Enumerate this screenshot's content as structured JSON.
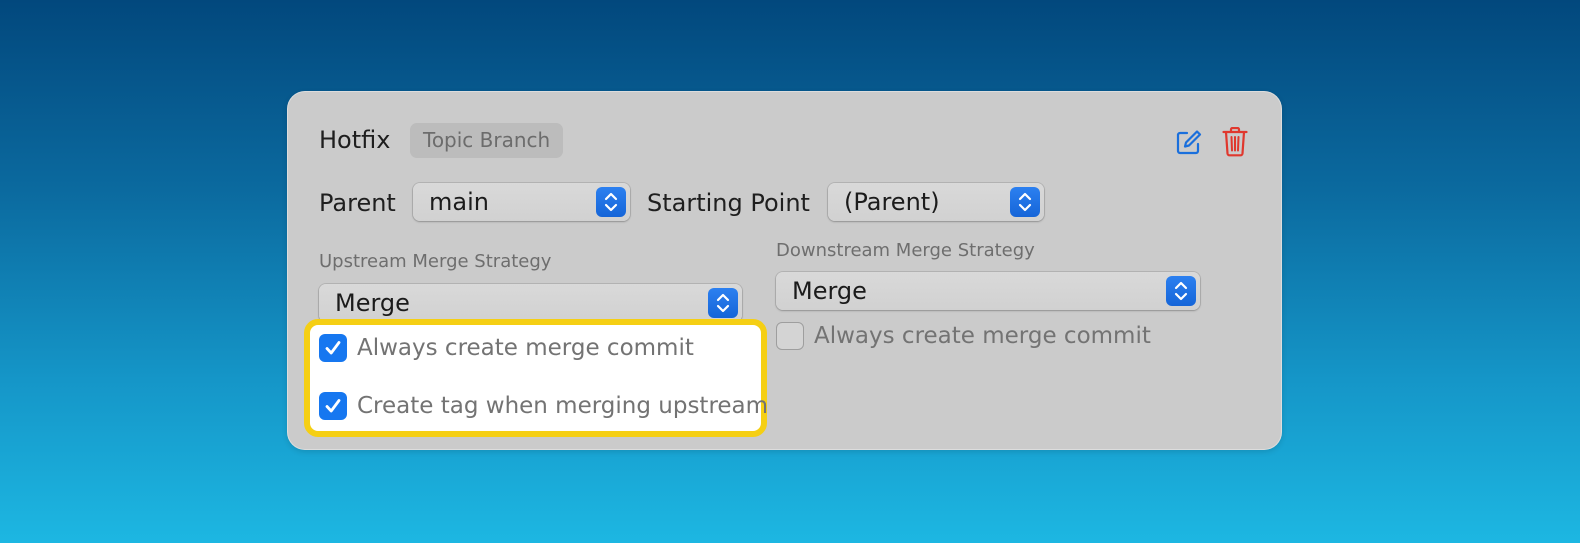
{
  "card": {
    "title": "Hotfix",
    "badge": "Topic Branch",
    "edit_icon": "edit-icon",
    "delete_icon": "trash-icon"
  },
  "parent": {
    "label": "Parent",
    "value": "main"
  },
  "starting_point": {
    "label": "Starting Point",
    "value": "(Parent)"
  },
  "upstream": {
    "label": "Upstream Merge Strategy",
    "value": "Merge",
    "options": [
      {
        "label": "Always create merge commit",
        "checked": true
      },
      {
        "label": "Create tag when merging upstream",
        "checked": true
      }
    ]
  },
  "downstream": {
    "label": "Downstream Merge Strategy",
    "value": "Merge",
    "options": [
      {
        "label": "Always create merge commit",
        "checked": false
      }
    ]
  },
  "colors": {
    "accent": "#1677f0",
    "highlight": "#f5cf14",
    "delete": "#e0382e"
  }
}
